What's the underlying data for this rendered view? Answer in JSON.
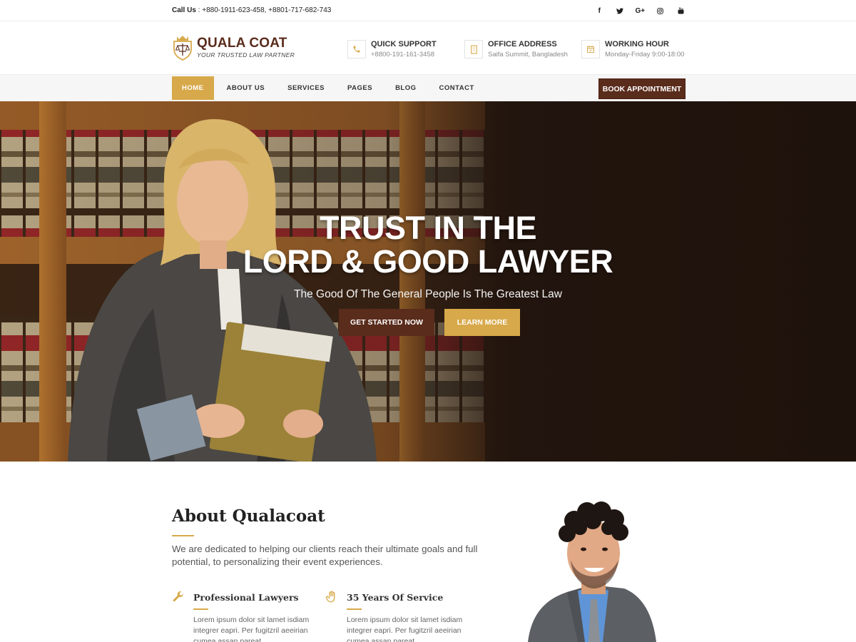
{
  "topbar": {
    "call_label": "Call Us",
    "call_numbers": " : +880-1911-623-458, +8801-717-682-743",
    "social": [
      "f",
      "t",
      "G+",
      "ig",
      "yt"
    ]
  },
  "logo": {
    "title": "QUALA COAT",
    "tagline": "YOUR TRUSTED LAW PARTNER"
  },
  "info": [
    {
      "title": "QUICK SUPPORT",
      "sub": "+8800-191-161-3458",
      "icon": "phone-icon"
    },
    {
      "title": "OFFICE ADDRESS",
      "sub": "Saifa Summit, Bangladesh",
      "icon": "building-icon"
    },
    {
      "title": "WORKING HOUR",
      "sub": "Monday-Friday 9:00-18:00",
      "icon": "calendar-icon"
    }
  ],
  "nav": {
    "items": [
      "HOME",
      "ABOUT US",
      "SERVICES",
      "PAGES",
      "BLOG",
      "CONTACT"
    ],
    "active": "HOME",
    "cta": "BOOK APPOINTMENT"
  },
  "hero": {
    "line1": "TRUST IN THE",
    "line2": "LORD & GOOD LAWYER",
    "subtitle": "The Good Of The General People Is The Greatest Law",
    "primary_button": "GET STARTED NOW",
    "secondary_button": "LEARN MORE"
  },
  "about": {
    "title": "About Qualacoat",
    "description": "We are dedicated to helping our clients reach their ultimate goals and full potential, to personalizing their event experiences.",
    "features": [
      {
        "title": "Professional Lawyers",
        "text": "Lorem ipsum dolor sit lamet isdiam integrer eapri. Per fugitzril aeeirian cumea assan pareat",
        "icon": "wrench-icon"
      },
      {
        "title": "35 Years Of Service",
        "text": "Lorem ipsum dolor sit lamet isdiam integrer eapri. Per fugitzril aeeirian cumea assan pareat",
        "icon": "hand-icon"
      }
    ]
  },
  "colors": {
    "brown": "#5a2c1c",
    "gold": "#d7a94a"
  }
}
